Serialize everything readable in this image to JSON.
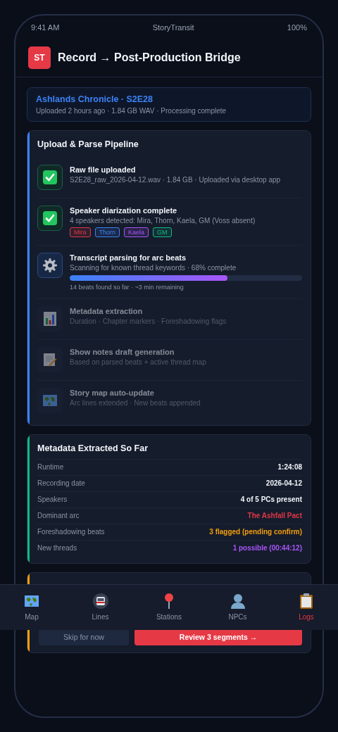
{
  "status_bar": {
    "time": "9:41 AM",
    "app": "StoryTransit",
    "battery": "100%"
  },
  "header": {
    "logo": "ST",
    "title": "Record → Post-Production Bridge"
  },
  "episode": {
    "title": "Ashlands Chronicle · S2E28",
    "subtitle": "Uploaded 2 hours ago · 1.84 GB WAV · Processing complete"
  },
  "pipeline": {
    "title": "Upload & Parse Pipeline",
    "steps": [
      {
        "title": "Raw file uploaded",
        "detail": "S2E28_raw_2026-04-12.wav · 1.84 GB · Uploaded via desktop app",
        "completed": true,
        "in_progress": false
      },
      {
        "title": "Speaker diarization complete",
        "detail": "4 speakers detected: Mira, Thorn, Kaela, GM (Voss absent)",
        "completed": true,
        "in_progress": false,
        "tags": [
          {
            "label": "Mira",
            "color": "#e23744"
          },
          {
            "label": "Thorn",
            "color": "#3b82f6"
          },
          {
            "label": "Kaela",
            "color": "#a855f7"
          },
          {
            "label": "GM",
            "color": "#10b981"
          }
        ]
      },
      {
        "title": "Transcript parsing for arc beats",
        "detail": "Scanning for known thread keywords · 68% complete",
        "completed": false,
        "in_progress": true,
        "level": 0.68,
        "note": "14 beats found so far · ~3 min remaining"
      },
      {
        "title": "Metadata extraction",
        "detail": "Duration · Chapter markers · Foreshadowing flags",
        "completed": false,
        "in_progress": false
      },
      {
        "title": "Show notes draft generation",
        "detail": "Based on parsed beats + active thread map",
        "completed": false,
        "in_progress": false
      },
      {
        "title": "Story map auto-update",
        "detail": "Arc lines extended · New beats appended",
        "completed": false,
        "in_progress": false
      }
    ]
  },
  "metadata": {
    "title": "Metadata Extracted So Far",
    "rows": [
      {
        "label": "Runtime",
        "value": "1:24:08",
        "color": "#f1f5f9"
      },
      {
        "label": "Recording date",
        "value": "2026-04-12",
        "color": "#f1f5f9"
      },
      {
        "label": "Speakers",
        "value": "4 of 5 PCs present",
        "color": "#f1f5f9"
      },
      {
        "label": "Dominant arc",
        "value": "The Ashfall Pact",
        "color": "#e23744"
      },
      {
        "label": "Foreshadowing beats",
        "value": "3 flagged (pending confirm)",
        "color": "#f59e0b"
      },
      {
        "label": "New threads",
        "value": "1 possible (00:44:12)",
        "color": "#a855f7"
      }
    ]
  },
  "review": {
    "buttons": [
      {
        "label": "Skip for now",
        "kind": "secondary"
      },
      {
        "label": "Review 3 segments →",
        "kind": "primary"
      }
    ]
  },
  "nav": {
    "items": [
      {
        "label": "Map",
        "selected": false
      },
      {
        "label": "Lines",
        "selected": false
      },
      {
        "label": "Stations",
        "selected": false
      },
      {
        "label": "NPCs",
        "selected": false
      },
      {
        "label": "Logs",
        "selected": true
      }
    ]
  }
}
